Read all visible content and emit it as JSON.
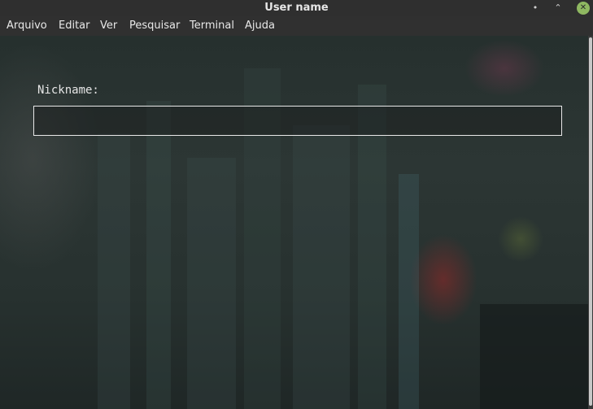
{
  "window": {
    "title": "User name",
    "controls": {
      "minimize_icon": "minimize-icon",
      "maximize_icon": "maximize-icon",
      "close_icon": "close-icon",
      "minimize_glyph": "•",
      "maximize_glyph": "⌃",
      "close_glyph": "✕"
    },
    "close_color": "#8fb861"
  },
  "menubar": {
    "items": [
      {
        "label": "Arquivo"
      },
      {
        "label": "Editar"
      },
      {
        "label": "Ver"
      },
      {
        "label": "Pesquisar"
      },
      {
        "label": "Terminal"
      },
      {
        "label": "Ajuda"
      }
    ]
  },
  "terminal": {
    "prompt_label": "Nickname:",
    "input_value": ""
  }
}
